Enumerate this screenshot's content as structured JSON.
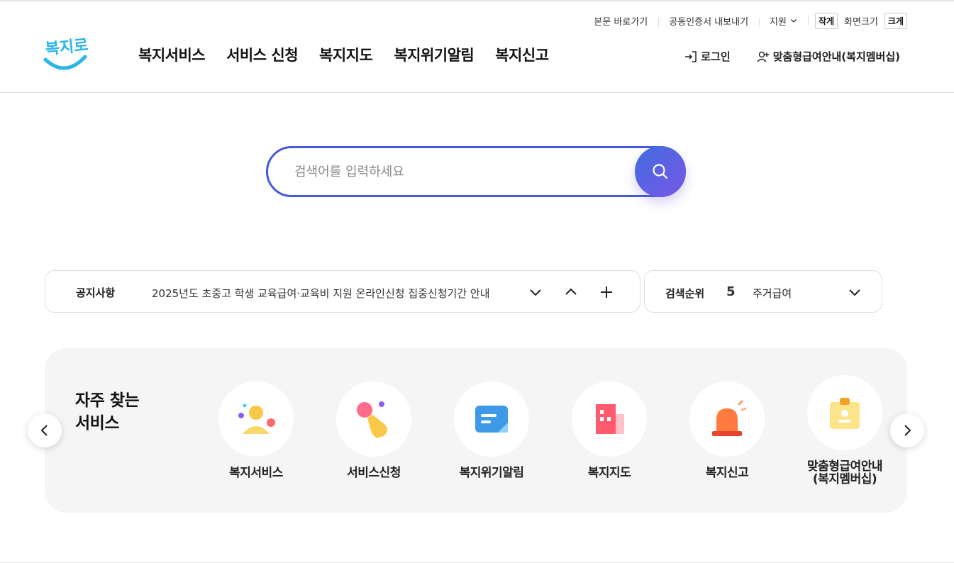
{
  "util": {
    "skip_link": "본문 바로가기",
    "cert_export": "공동인증서 내보내기",
    "support": "지원",
    "font_small": "작게",
    "font_label": "화면크기",
    "font_large": "크게"
  },
  "logo": {
    "text": "복지로",
    "brand_color": "#2bb5e8"
  },
  "gnb": {
    "items": [
      {
        "label": "복지서비스"
      },
      {
        "label": "서비스 신청"
      },
      {
        "label": "복지지도"
      },
      {
        "label": "복지위기알림"
      },
      {
        "label": "복지신고"
      }
    ]
  },
  "header": {
    "login": "로그인",
    "membership": "맞춤형급여안내(복지멤버십)"
  },
  "search": {
    "placeholder": "검색어를 입력하세요",
    "value": "",
    "accent": "#4759d6"
  },
  "notice": {
    "label": "공지사항",
    "text": "2025년도 초중고 학생 교육급여·교육비 지원 온라인신청 집중신청기간 안내"
  },
  "rank": {
    "label": "검색순위",
    "number": "5",
    "keyword": "주거급여"
  },
  "freq": {
    "title": "자주 찾는\n서비스",
    "items": [
      {
        "label": "복지서비스",
        "icon": "person-icon"
      },
      {
        "label": "서비스신청",
        "icon": "hand-tap-icon"
      },
      {
        "label": "복지위기알림",
        "icon": "message-icon"
      },
      {
        "label": "복지지도",
        "icon": "map-building-icon"
      },
      {
        "label": "복지신고",
        "icon": "siren-icon"
      },
      {
        "label": "맞춤형급여안내\n(복지멤버십)",
        "icon": "id-badge-icon"
      }
    ]
  }
}
